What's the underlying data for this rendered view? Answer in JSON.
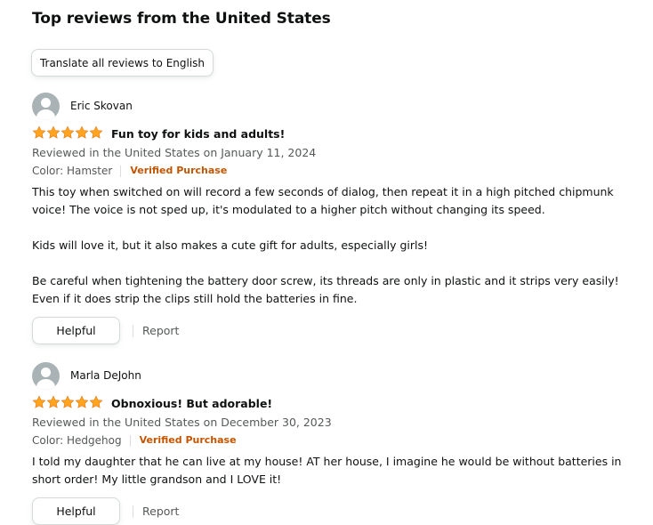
{
  "heading": "Top reviews from the United States",
  "translate_button": "Translate all reviews to English",
  "colors": {
    "star": "#FFA41C",
    "verified": "#C45500",
    "secondary_text": "#565959"
  },
  "reviews": [
    {
      "author": "Eric Skovan",
      "rating": 5,
      "title": "Fun toy for kids and adults!",
      "date": "Reviewed in the United States on January 11, 2024",
      "variant": "Color: Hamster",
      "verified": "Verified Purchase",
      "body": [
        "This toy when switched on will record a few seconds of dialog, then repeat it in a high pitched chipmunk voice! The voice is not sped up, it's modulated to a higher pitch without changing its speed.",
        "Kids will love it, but it also makes a cute gift for adults, especially girls!",
        "Be careful when tightening the battery door screw, its threads are only in plastic and it strips very easily! Even if it does strip the clips still hold the batteries in fine."
      ],
      "helpful_label": "Helpful",
      "report_label": "Report"
    },
    {
      "author": "Marla DeJohn",
      "rating": 5,
      "title": "Obnoxious! But adorable!",
      "date": "Reviewed in the United States on December 30, 2023",
      "variant": "Color: Hedgehog",
      "verified": "Verified Purchase",
      "body": [
        "I told my daughter that he can live at my house! AT her house, I imagine he would be without batteries in short order! My little grandson and I LOVE it!"
      ],
      "helpful_label": "Helpful",
      "report_label": "Report"
    }
  ]
}
